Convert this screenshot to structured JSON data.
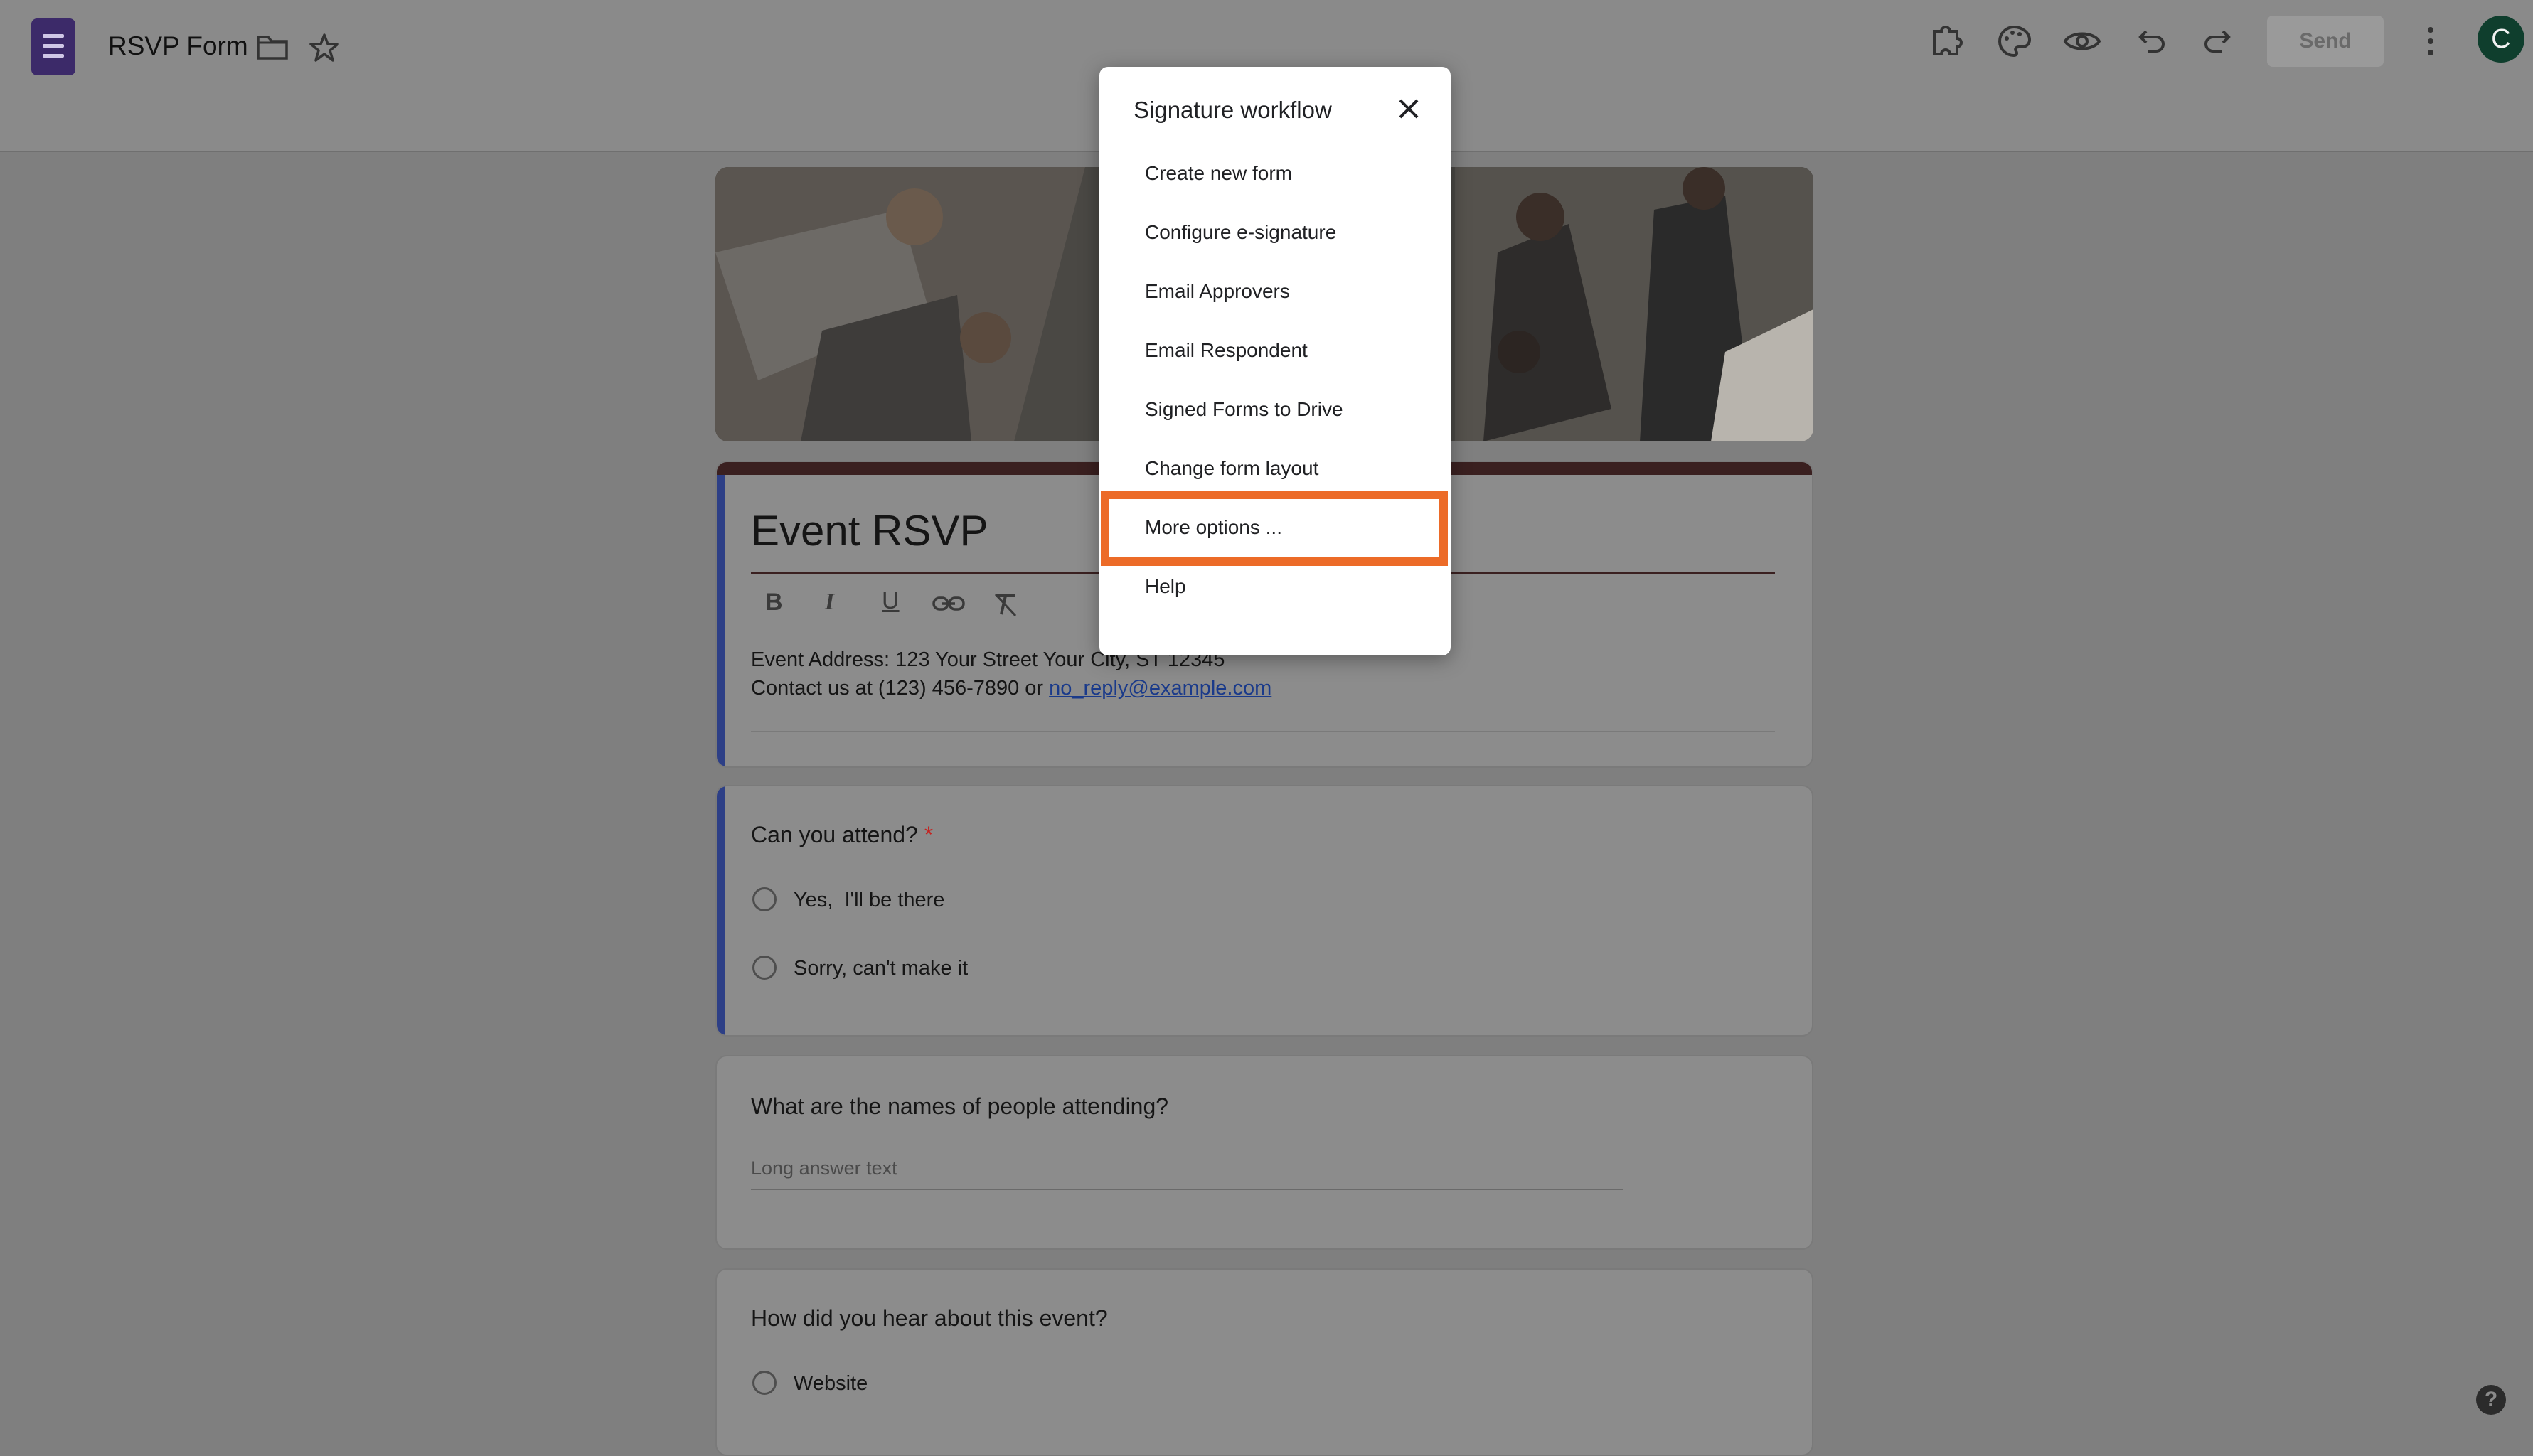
{
  "header": {
    "form_title": "RSVP Form",
    "send_label": "Send",
    "avatar_initial": "C",
    "icons": [
      "addons-icon",
      "palette-icon",
      "preview-eye-icon",
      "undo-icon",
      "redo-icon",
      "more-vert-icon",
      "folder-icon",
      "star-icon"
    ]
  },
  "form": {
    "title": "Event RSVP",
    "description_line1": "Event Address: 123 Your Street Your City, ST 12345",
    "description_line2_prefix": "Contact us at (123) 456-7890 or ",
    "email_link": "no_reply@example.com",
    "questions": [
      {
        "text": "Can you attend?",
        "required_mark": "*",
        "options": [
          "Yes,  I'll be there",
          "Sorry, can't make it"
        ]
      },
      {
        "text": "What are the names of people attending?",
        "placeholder": "Long answer text"
      },
      {
        "text": "How did you hear about this event?",
        "options": [
          "Website"
        ]
      }
    ]
  },
  "modal": {
    "title": "Signature workflow",
    "items": [
      "Create new form",
      "Configure e-signature",
      "Email Approvers",
      "Email Respondent",
      "Signed Forms to Drive",
      "Change form layout",
      "More options ...",
      "Help"
    ],
    "highlighted_item": "More options ..."
  },
  "help_fab": "?",
  "colors": {
    "highlight": "#ec6b28",
    "accent": "#2d3f86",
    "header_band": "#3a2020",
    "link": "#1a3a8a"
  }
}
